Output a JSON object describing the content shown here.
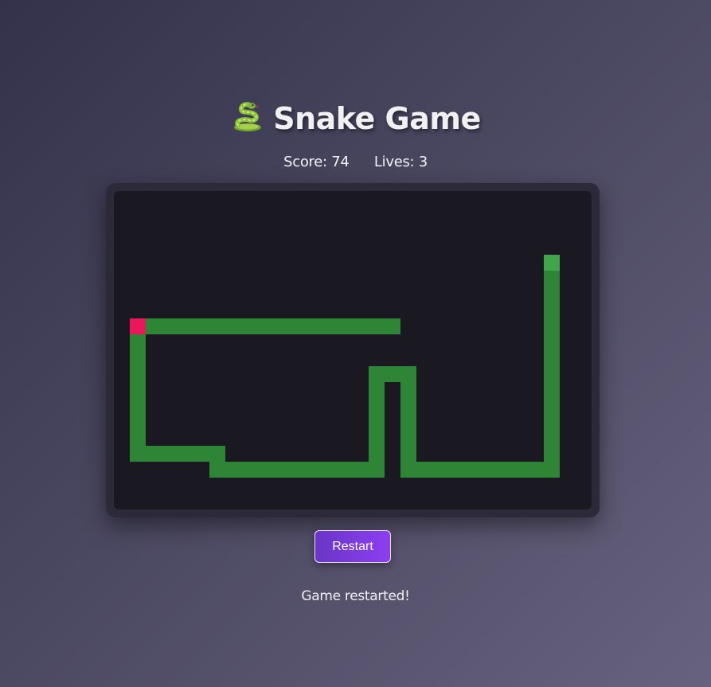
{
  "header": {
    "title": "Snake Game",
    "icon": "snake-icon"
  },
  "stats": {
    "score_label": "Score: 74",
    "lives_label": "Lives: 3",
    "score": 74,
    "lives": 3
  },
  "board": {
    "grid_cols": 30,
    "grid_rows": 20,
    "background_color": "#1a1820",
    "snake_color": "#2e8535",
    "head_color": "#43a54b",
    "food_color": "#e8185a",
    "snake_head": {
      "col": 27,
      "row": 4
    },
    "snake_path": [
      {
        "col": 27,
        "row": 4
      },
      {
        "col": 27,
        "row": 17
      },
      {
        "col": 18,
        "row": 17
      },
      {
        "col": 18,
        "row": 11
      },
      {
        "col": 16,
        "row": 11
      },
      {
        "col": 16,
        "row": 17
      },
      {
        "col": 6,
        "row": 17
      },
      {
        "col": 6,
        "row": 16
      },
      {
        "col": 1,
        "row": 16
      },
      {
        "col": 1,
        "row": 8
      },
      {
        "col": 17,
        "row": 8
      }
    ],
    "food": {
      "col": 1,
      "row": 8
    }
  },
  "controls": {
    "restart_label": "Restart"
  },
  "status": {
    "message": "Game restarted!"
  }
}
